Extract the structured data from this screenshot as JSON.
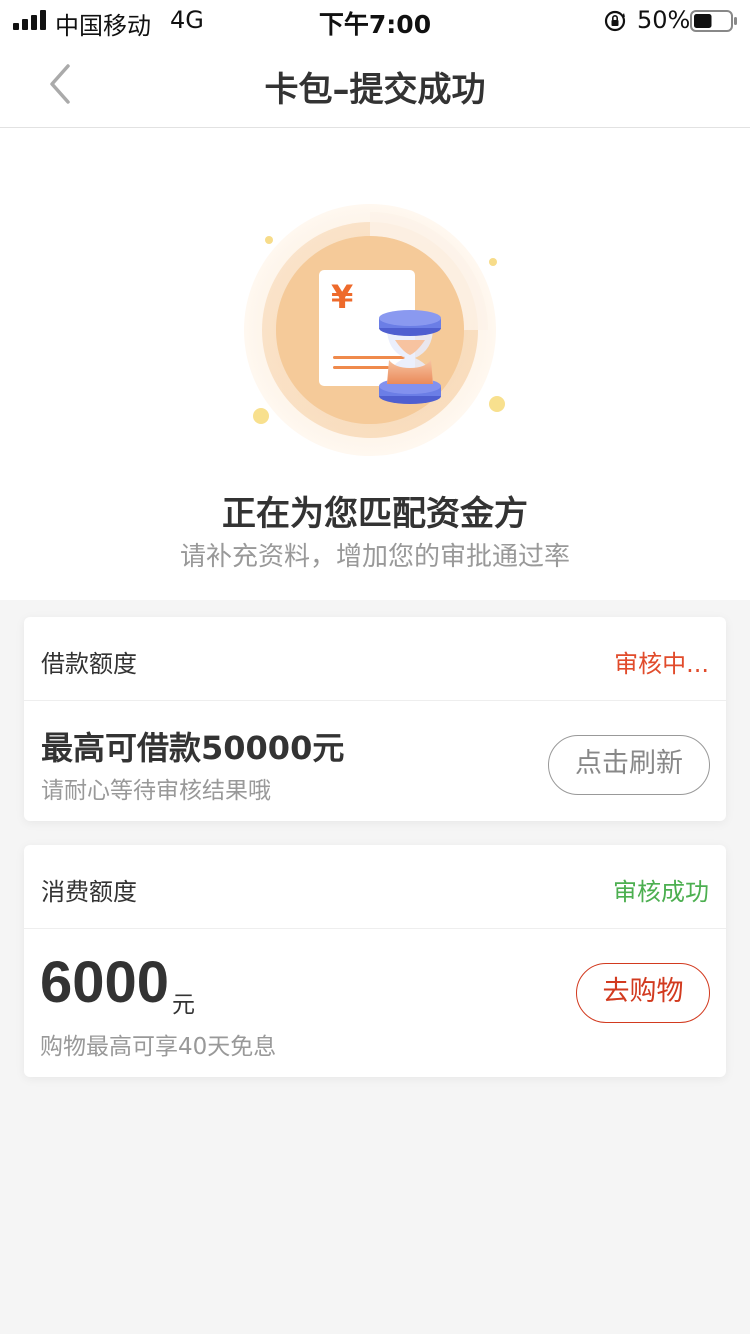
{
  "status_bar": {
    "carrier": "中国移动",
    "network": "4G",
    "time": "下午7:00",
    "battery": "50%",
    "battery_level": 0.5
  },
  "nav": {
    "title": "卡包–提交成功"
  },
  "hero": {
    "title": "正在为您匹配资金方",
    "subtitle": "请补充资料，增加您的审批通过率",
    "currency_symbol": "¥"
  },
  "loan_card": {
    "label": "借款额度",
    "status": "审核中...",
    "amount_text": "最高可借款50000元",
    "hint": "请耐心等待审核结果哦",
    "button_label": "点击刷新"
  },
  "consume_card": {
    "label": "消费额度",
    "status": "审核成功",
    "amount": "6000",
    "unit": "元",
    "hint": "购物最高可享40天免息",
    "button_label": "去购物"
  },
  "colors": {
    "accent_red": "#d23a1f",
    "success_green": "#4caf50",
    "hourglass_blue": "#6b7ee6",
    "illustration_orange": "#f0b77a"
  }
}
